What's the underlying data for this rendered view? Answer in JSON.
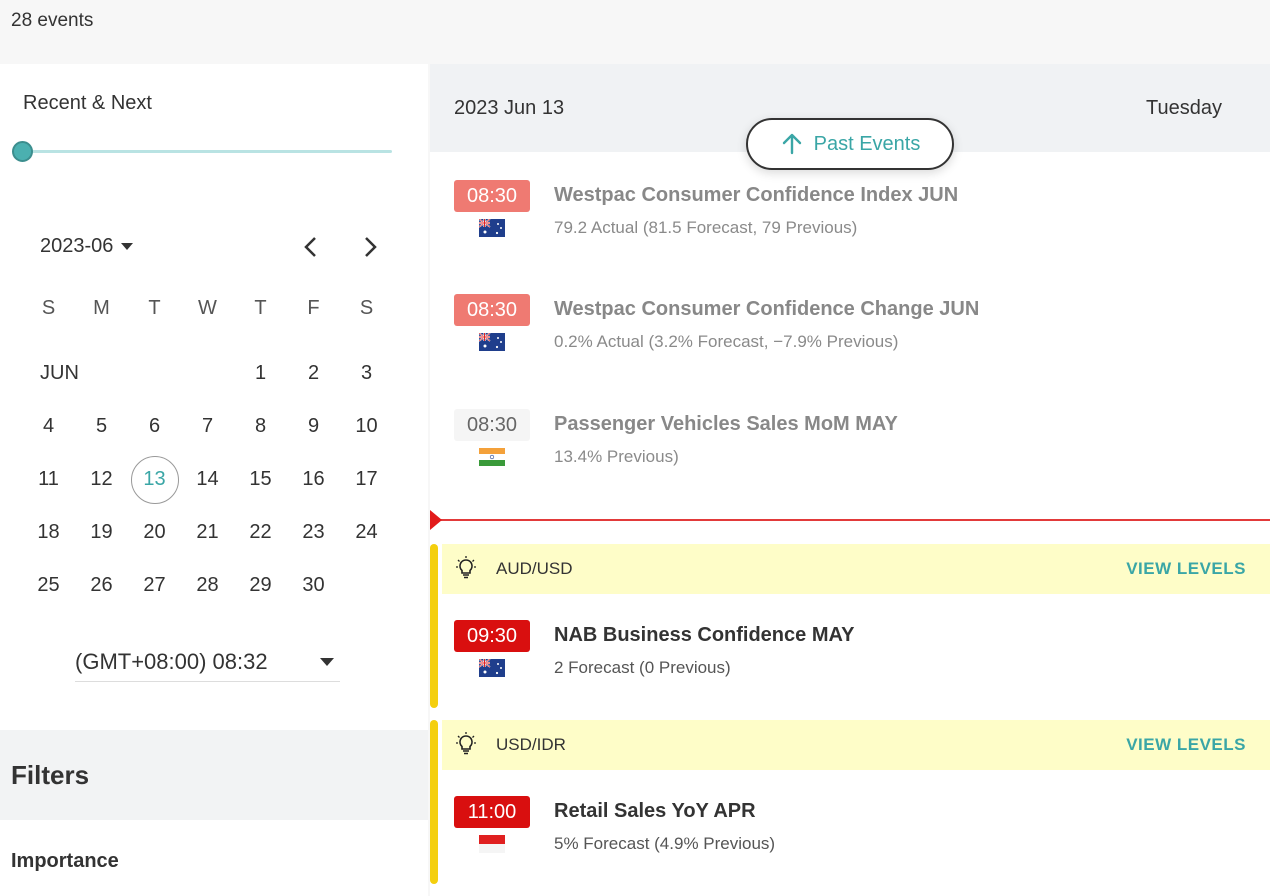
{
  "header": {
    "events_count": "28 events"
  },
  "sidebar": {
    "range_label": "Recent & Next",
    "calendar": {
      "month_select": "2023-06",
      "weekdays": [
        "S",
        "M",
        "T",
        "W",
        "T",
        "F",
        "S"
      ],
      "month_label": "JUN",
      "weeks": [
        [
          "",
          "",
          "",
          "",
          "1",
          "2",
          "3"
        ],
        [
          "4",
          "5",
          "6",
          "7",
          "8",
          "9",
          "10"
        ],
        [
          "11",
          "12",
          "13",
          "14",
          "15",
          "16",
          "17"
        ],
        [
          "18",
          "19",
          "20",
          "21",
          "22",
          "23",
          "24"
        ],
        [
          "25",
          "26",
          "27",
          "28",
          "29",
          "30",
          ""
        ]
      ],
      "today": "13"
    },
    "timezone": "(GMT+08:00) 08:32",
    "filters_title": "Filters",
    "importance_label": "Importance"
  },
  "main": {
    "date": "2023 Jun 13",
    "day": "Tuesday",
    "past_events_label": "Past Events",
    "events": [
      {
        "time": "08:30",
        "title": "Westpac Consumer Confidence Index JUN",
        "detail": "79.2 Actual (81.5 Forecast, 79 Previous)",
        "country": "AU",
        "importance": "medium"
      },
      {
        "time": "08:30",
        "title": "Westpac Consumer Confidence Change JUN",
        "detail": "0.2% Actual (3.2% Forecast, −7.9% Previous)",
        "country": "AU",
        "importance": "medium"
      },
      {
        "time": "08:30",
        "title": "Passenger Vehicles Sales MoM MAY",
        "detail": "13.4% Previous)",
        "country": "IN",
        "importance": "low"
      }
    ],
    "groups": [
      {
        "pair": "AUD/USD",
        "view_levels": "VIEW LEVELS",
        "event": {
          "time": "09:30",
          "title": "NAB Business Confidence MAY",
          "detail": "2 Forecast (0 Previous)",
          "country": "AU",
          "importance": "high"
        }
      },
      {
        "pair": "USD/IDR",
        "view_levels": "VIEW LEVELS",
        "event": {
          "time": "11:00",
          "title": "Retail Sales YoY APR",
          "detail": "5% Forecast (4.9% Previous)",
          "country": "ID",
          "importance": "high"
        }
      }
    ]
  },
  "colors": {
    "accent": "#3aa6a6",
    "high": "#d90f0f",
    "medium": "#ef7a72",
    "group_bar": "#f4cf0e",
    "group_bg": "#fefdc8"
  }
}
